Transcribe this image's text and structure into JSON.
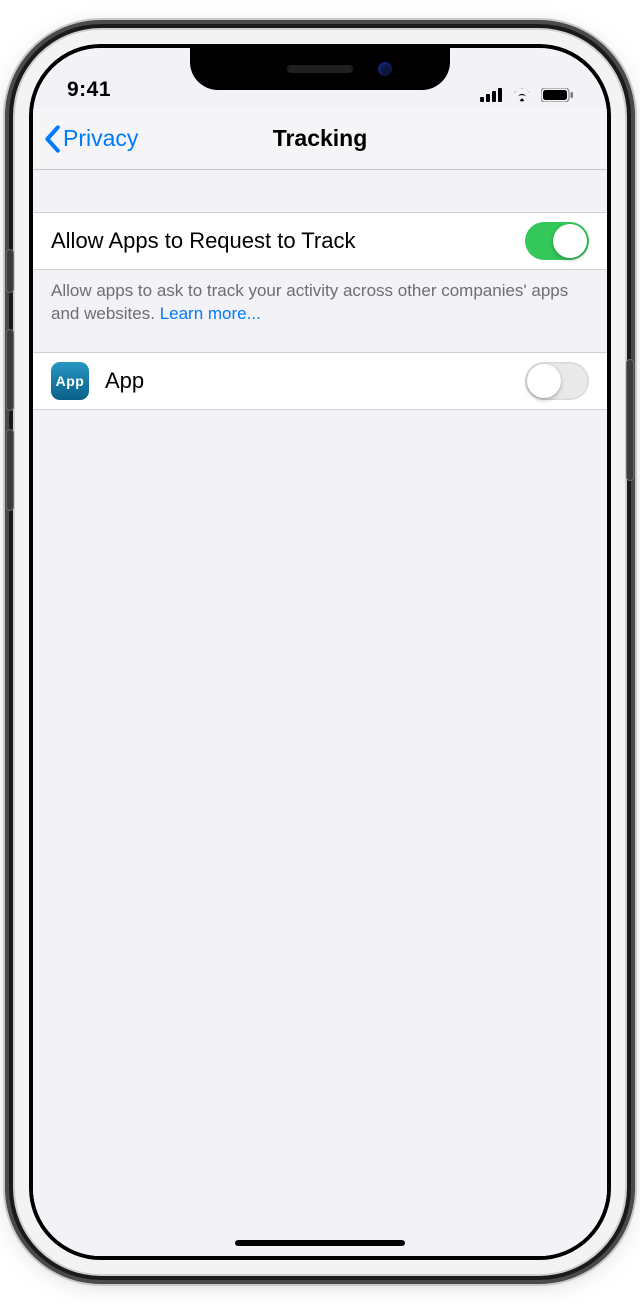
{
  "status": {
    "time": "9:41"
  },
  "nav": {
    "back_label": "Privacy",
    "title": "Tracking"
  },
  "colors": {
    "tint": "#007aff",
    "toggle_on": "#34c759"
  },
  "rows": {
    "allow_request": {
      "label": "Allow Apps to Request to Track",
      "enabled": true
    },
    "app": {
      "label": "App",
      "icon_text": "App",
      "enabled": false
    }
  },
  "footer": {
    "text": "Allow apps to ask to track your activity across other companies' apps and websites. ",
    "link": "Learn more..."
  }
}
